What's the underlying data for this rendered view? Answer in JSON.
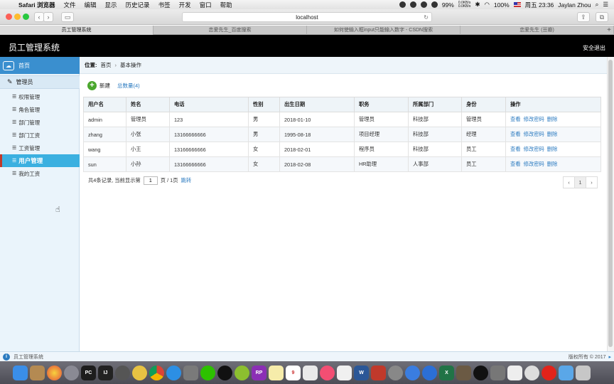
{
  "mac_menubar": {
    "apple_glyph": "",
    "app_name": "Safari 浏览器",
    "menus": [
      "文件",
      "编辑",
      "显示",
      "历史记录",
      "书签",
      "开发",
      "窗口",
      "帮助"
    ],
    "battery_text": "99%",
    "net_up": "0.0KB/s",
    "net_down": "0.0KB/s",
    "battery2": "100%",
    "clock": "周五 23:36",
    "user": "Jaylan Zhou"
  },
  "browser": {
    "url": "localhost",
    "tabs": [
      "员工管理系统",
      "恋爱先生_百度搜索",
      "如何使输入框input只能输入数字 - CSDN搜索",
      "恋爱先生 (豆瓣)"
    ],
    "back": "‹",
    "forward": "›",
    "new_tab": "+",
    "reload": "↻"
  },
  "app": {
    "title": "员工管理系统",
    "logout": "安全退出"
  },
  "sidebar": {
    "home": "首页",
    "group": "管理员",
    "items": [
      "权限管理",
      "角色管理",
      "部门管理",
      "部门工资",
      "工资管理",
      "用户管理",
      "我的工资"
    ],
    "active": "用户管理"
  },
  "breadcrumb": {
    "label": "位置:",
    "home": "首页",
    "sep": "›",
    "current": "基本操作"
  },
  "toolbar": {
    "add_label": "新建",
    "total_label": "总数量(4)"
  },
  "table": {
    "headers": [
      "用户名",
      "姓名",
      "电话",
      "性别",
      "出生日期",
      "职务",
      "所属部门",
      "身份",
      "操作"
    ],
    "rows": [
      [
        "admin",
        "管理员",
        "123",
        "男",
        "2018-01-10",
        "管理员",
        "科技部",
        "管理员"
      ],
      [
        "zhang",
        "小张",
        "13166666666",
        "男",
        "1995-08-18",
        "项目经理",
        "科技部",
        "经理"
      ],
      [
        "wang",
        "小王",
        "13166666666",
        "女",
        "2018-02-01",
        "程序员",
        "科技部",
        "员工"
      ],
      [
        "sun",
        "小孙",
        "13166666666",
        "女",
        "2018-02-08",
        "HR助理",
        "人事部",
        "员工"
      ]
    ],
    "ops": [
      "查看",
      "修改密码",
      "删除"
    ]
  },
  "pager": {
    "summary": "共4条记录,  当前显示第",
    "page_value": "1",
    "suffix": "页 / 1页",
    "jump": "跳转",
    "prev": "‹",
    "current": "1",
    "next": "›"
  },
  "statusbar": {
    "info": "i",
    "text": "员工管理系统",
    "copyright": "版权所有 © 2017",
    "arrow": "▸"
  },
  "colors": {
    "sidebar_active": "#3bb0e0",
    "home_bar": "#3a8fcf",
    "header_bg": "#000000",
    "link": "#2a7ac0",
    "add_icon": "#4aa72d"
  },
  "dock": [
    "finder",
    "launchpad",
    "photos",
    "safari",
    "pycharm",
    "intellij",
    "terminal",
    "chrome",
    "notes",
    "wechat",
    "qq",
    "axure",
    "calendar",
    "itunes",
    "word",
    "excel",
    "system-preferences",
    "trash"
  ]
}
